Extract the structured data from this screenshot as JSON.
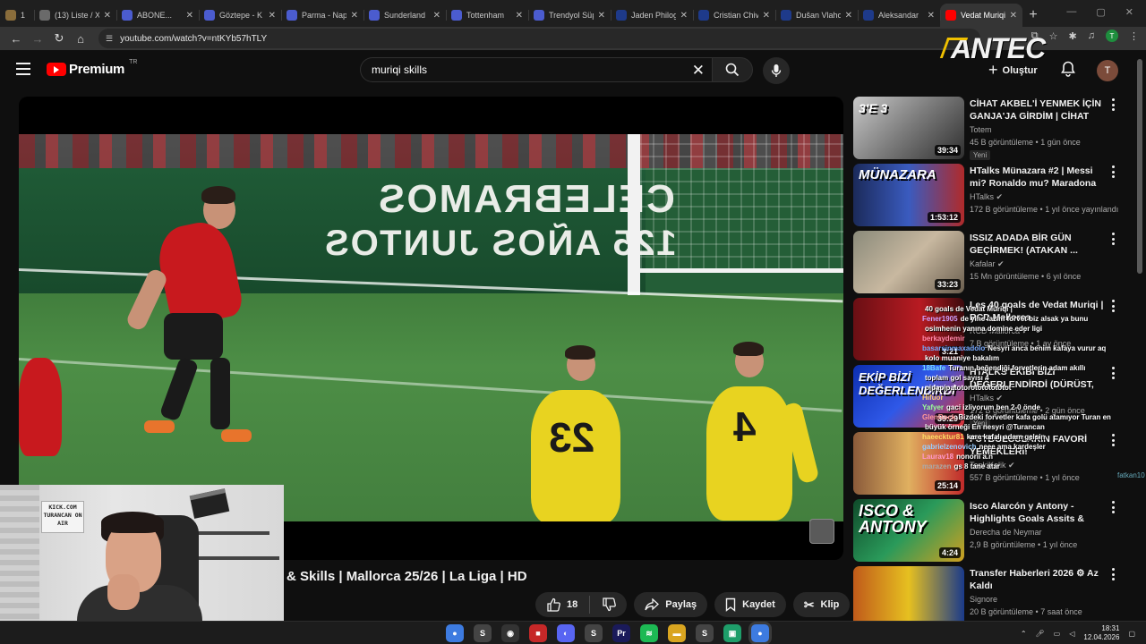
{
  "browser": {
    "tabs": [
      {
        "label": "1",
        "favicon_color": "#8a6d3b"
      },
      {
        "label": "(13) Liste / X",
        "favicon_color": "#6a6a6a"
      },
      {
        "label": "ABONE...",
        "favicon_color": "#4b5ccf"
      },
      {
        "label": "Göztepe - K",
        "favicon_color": "#4b5ccf"
      },
      {
        "label": "Parma - Nap",
        "favicon_color": "#4b5ccf"
      },
      {
        "label": "Sunderland",
        "favicon_color": "#4b5ccf"
      },
      {
        "label": "Tottenham",
        "favicon_color": "#4b5ccf"
      },
      {
        "label": "Trendyol Süp",
        "favicon_color": "#4b5ccf"
      },
      {
        "label": "Jaden Philog",
        "favicon_color": "#1e3a8a"
      },
      {
        "label": "Cristian Chiv",
        "favicon_color": "#1e3a8a"
      },
      {
        "label": "Dušan Vlaho",
        "favicon_color": "#1e3a8a"
      },
      {
        "label": "Aleksandar",
        "favicon_color": "#1e3a8a"
      },
      {
        "label": "Vedat Muriqi",
        "favicon_color": "#ff0000"
      }
    ],
    "new_tab_label": "+",
    "url": "youtube.com/watch?v=ntKYb57hTLY"
  },
  "youtube": {
    "brand": "Premium",
    "country_code": "TR",
    "search_query": "muriqi skills",
    "create_label": "Oluştur",
    "avatar_letter": "T"
  },
  "overlay_logo": "ANTEC",
  "player": {
    "ad_line_1": "CELEBRAMOS",
    "ad_line_2": "125 AÑOS JUNTOS",
    "yellow_number_1": "23",
    "yellow_number_2": "4"
  },
  "video": {
    "title": "& Skills | Mallorca 25/26 | La Liga | HD",
    "like_count": "18",
    "share_label": "Paylaş",
    "save_label": "Kaydet",
    "clip_label": "Klip"
  },
  "webcam": {
    "sign_text": "KICK.COM TURANCAN ON AIR"
  },
  "recommendations": [
    {
      "title": "CİHAT AKBEL'İ YENMEK İÇİN GANJA'JA GİRDİM | CİHAT AKBE...",
      "channel": "Totem",
      "meta": "45 B görüntüleme • 1 gün önce",
      "badge": "Yeni",
      "duration": "39:34",
      "thumb_text": "3'E 3"
    },
    {
      "title": "HTalks Münazara #2 | Messi mi? Ronaldo mu? Maradona mı?",
      "channel": "HTalks ✔",
      "meta": "172 B görüntüleme • 1 yıl önce yayınlandı",
      "badge": "",
      "duration": "1:53:12",
      "thumb_text": "MÜNAZARA"
    },
    {
      "title": "ISSIZ ADADA BİR GÜN GEÇİRMEK! (ATAKAN ...",
      "channel": "Kafalar ✔",
      "meta": "15 Mn görüntüleme • 6 yıl önce",
      "badge": "",
      "duration": "33:23",
      "thumb_text": ""
    },
    {
      "title": "Les 40 goals de Vedat Muriqi | RCD Mallorca",
      "channel": "RCD Mallorca ✔",
      "meta": "7 B görüntüleme • 1 ay önce",
      "badge": "",
      "duration": "3:21",
      "thumb_text": ""
    },
    {
      "title": "HTALKS EKİBİ BİZİ DEĞERLENDİRDİ (DÜRÜST, ...",
      "channel": "HTalks ✔",
      "meta": "172 B görüntüleme • 2 gün önce",
      "badge": "Yeni",
      "duration": "39:29",
      "thumb_text": "EKİP BİZİ DEĞERLENDİRDİ"
    },
    {
      "title": "FUTBOLCULARIN FAVORİ YEMEKLERİ!",
      "channel": "TepkiKolik ✔",
      "meta": "557 B görüntüleme • 1 yıl önce",
      "badge": "",
      "duration": "25:14",
      "thumb_text": ""
    },
    {
      "title": "Isco Alarcón y Antony - Highlights Goals Assits & Skill...",
      "channel": "Derecha de Neymar",
      "meta": "2,9 B görüntüleme • 1 yıl önce",
      "badge": "",
      "duration": "4:24",
      "thumb_text": "ISCO & ANTONY"
    },
    {
      "title": "Transfer Haberleri 2026 ⚙ Az Kaldı",
      "channel": "Signore",
      "meta": "20 B görüntüleme • 7 saat önce",
      "badge": "",
      "duration": "",
      "thumb_text": ""
    }
  ],
  "chat": [
    {
      "user": "",
      "text": "40 goals de Vedat Muriqi |",
      "color": "#9bd"
    },
    {
      "user": "Fener1905",
      "text": "de yine lazım forvet biz alsak ya bunu",
      "color": "#d0a0ff"
    },
    {
      "user": "",
      "text": "osimhenin yanına domine eder ligi",
      "color": "#ccc"
    },
    {
      "user": "berkaydemir",
      "text": "",
      "color": "#f8a"
    },
    {
      "user": "basarsinmaxadolo",
      "text": "Nesyri anca benim kafaya vurur aq",
      "color": "#7af"
    },
    {
      "user": "",
      "text": "kolo muaniye bakalım",
      "color": "#ccc"
    },
    {
      "user": "18Bafe",
      "text": "Turanın beğendiği forvetlerin adam akıllı",
      "color": "#7df"
    },
    {
      "user": "",
      "text": "toplam gol sayısı 4",
      "color": "#ccc"
    },
    {
      "user": "",
      "text": "pipapipatotorotototototot",
      "color": "#ccc"
    },
    {
      "user": "Hifuor",
      "text": "",
      "color": "#fc7"
    },
    {
      "user": "Yafyer",
      "text": "gaci izliyorum ben 2-0 önde",
      "color": "#9f9"
    },
    {
      "user": "GlenRock",
      "text": "Bizdeki forvetler kafa golü atamıyor Turan en",
      "color": "#f99"
    },
    {
      "user": "",
      "text": "büyük örneği En nesyri @Turancan",
      "color": "#ccc"
    },
    {
      "user": "haeecktur81",
      "text": "kare kafalı adam gelsin",
      "color": "#fd6"
    },
    {
      "user": "gabrielzenovich",
      "text": "neee ama kardeşler",
      "color": "#9cf"
    },
    {
      "user": "Laurav18",
      "text": "nonoriı a.n",
      "color": "#f9c"
    },
    {
      "user": "marazen",
      "text": "gs 8 tane atar",
      "color": "#aaa"
    }
  ],
  "chat_overflow_user": "fatkan10",
  "taskbar": {
    "time": "18:31",
    "date": "12.04.2026",
    "apps": [
      {
        "name": "chrome",
        "color": "#3d7be0",
        "glyph": "●"
      },
      {
        "name": "app-s1",
        "color": "#444",
        "glyph": "S"
      },
      {
        "name": "obs",
        "color": "#333",
        "glyph": "◉"
      },
      {
        "name": "app-red",
        "color": "#c62828",
        "glyph": "■"
      },
      {
        "name": "discord-like",
        "color": "#5865f2",
        "glyph": "◐"
      },
      {
        "name": "app-s2",
        "color": "#444",
        "glyph": "S"
      },
      {
        "name": "premiere",
        "color": "#1a1a5a",
        "glyph": "Pr"
      },
      {
        "name": "spotify",
        "color": "#1db954",
        "glyph": "≋"
      },
      {
        "name": "explorer",
        "color": "#d9a520",
        "glyph": "▬"
      },
      {
        "name": "app-s3",
        "color": "#444",
        "glyph": "S"
      },
      {
        "name": "app-green",
        "color": "#1e9e6a",
        "glyph": "▣"
      },
      {
        "name": "chrome-active",
        "color": "#3d7be0",
        "glyph": "●"
      }
    ]
  }
}
